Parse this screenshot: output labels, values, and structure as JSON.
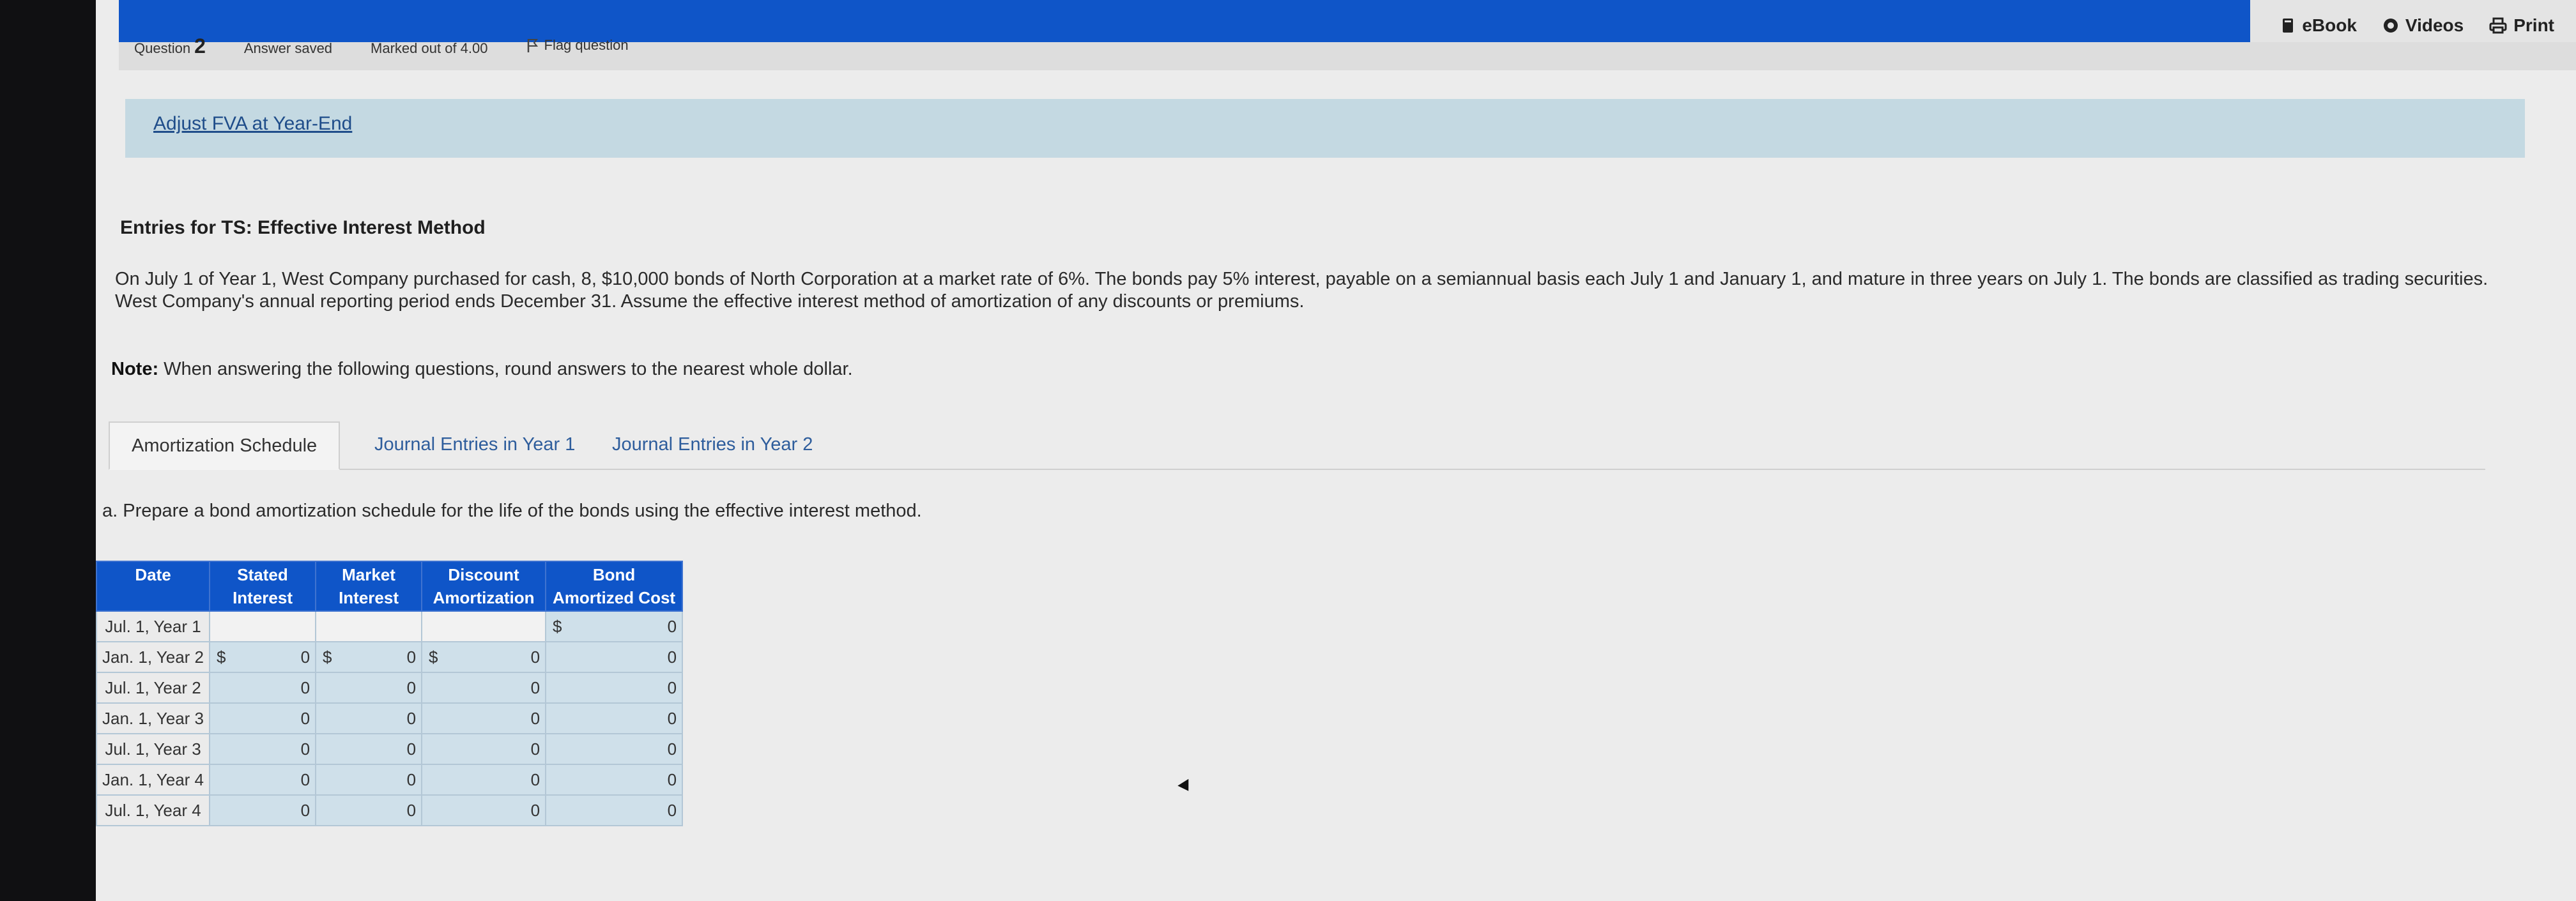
{
  "header": {
    "ebook_label": "eBook",
    "videos_label": "Videos",
    "print_label": "Print"
  },
  "question_bar": {
    "question_word": "Question",
    "question_number": "2",
    "status": "Answer saved",
    "marks": "Marked out of 4.00",
    "flag_label": "Flag question"
  },
  "banner": {
    "link_text": "Adjust FVA at Year-End"
  },
  "content": {
    "heading": "Entries for TS: Effective Interest Method",
    "paragraph": "On July 1 of Year 1, West Company purchased for cash, 8, $10,000 bonds of North Corporation at a market rate of 6%. The bonds pay 5% interest, payable on a semiannual basis each July 1 and January 1, and mature in three years on July 1. The bonds are classified as trading securities. West Company's annual reporting period ends December 31. Assume the effective interest method of amortization of any discounts or premiums.",
    "note_label": "Note:",
    "note_text": "When answering the following questions, round answers to the nearest whole dollar."
  },
  "tabs": [
    {
      "label": "Amortization Schedule",
      "active": true
    },
    {
      "label": "Journal Entries in Year 1",
      "active": false
    },
    {
      "label": "Journal Entries in Year 2",
      "active": false
    }
  ],
  "question_text": "a. Prepare a bond amortization schedule for the life of the bonds using the effective interest method.",
  "table": {
    "headers": {
      "date": "Date",
      "stated_1": "Stated",
      "stated_2": "Interest",
      "market_1": "Market",
      "market_2": "Interest",
      "discount_1": "Discount",
      "discount_2": "Amortization",
      "bond_1": "Bond",
      "bond_2": "Amortized Cost"
    },
    "currency_symbol": "$",
    "rows": [
      {
        "date": "Jul. 1, Year 1",
        "stated": "",
        "market": "",
        "discount": "",
        "bond": "0"
      },
      {
        "date": "Jan. 1, Year 2",
        "stated": "0",
        "market": "0",
        "discount": "0",
        "bond": "0"
      },
      {
        "date": "Jul. 1, Year 2",
        "stated": "0",
        "market": "0",
        "discount": "0",
        "bond": "0"
      },
      {
        "date": "Jan. 1, Year 3",
        "stated": "0",
        "market": "0",
        "discount": "0",
        "bond": "0"
      },
      {
        "date": "Jul. 1, Year 3",
        "stated": "0",
        "market": "0",
        "discount": "0",
        "bond": "0"
      },
      {
        "date": "Jan. 1, Year 4",
        "stated": "0",
        "market": "0",
        "discount": "0",
        "bond": "0"
      },
      {
        "date": "Jul. 1, Year 4",
        "stated": "0",
        "market": "0",
        "discount": "0",
        "bond": "0"
      }
    ]
  }
}
